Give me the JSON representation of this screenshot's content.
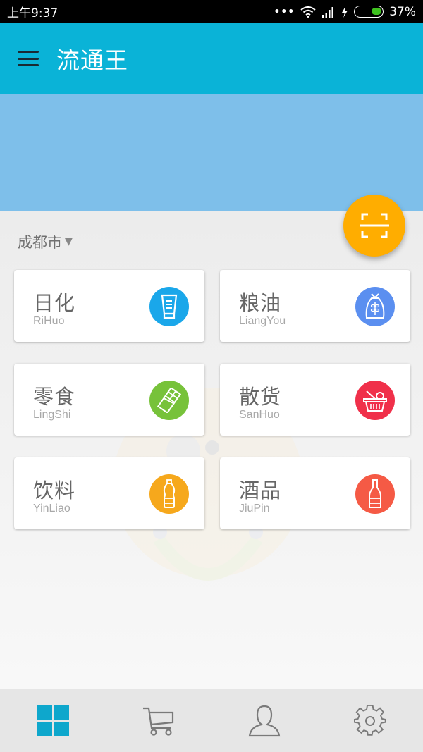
{
  "status_bar": {
    "time": "上午9:37",
    "dots": "•••",
    "battery_percent": "37%",
    "battery_level": 0.37
  },
  "app_bar": {
    "title": "流通王",
    "menu_icon": "hamburger-menu-icon"
  },
  "location": {
    "city": "成都市",
    "dropdown_glyph": "▼"
  },
  "fab": {
    "icon": "scan-icon"
  },
  "categories": [
    {
      "name": "日化",
      "pinyin": "RiHuo",
      "icon": "lotion-tube-icon",
      "color": "#1aa7ea"
    },
    {
      "name": "粮油",
      "pinyin": "LiangYou",
      "icon": "grain-sack-icon",
      "color": "#5b8ff0"
    },
    {
      "name": "零食",
      "pinyin": "LingShi",
      "icon": "chocolate-bar-icon",
      "color": "#77c23a"
    },
    {
      "name": "散货",
      "pinyin": "SanHuo",
      "icon": "basket-icon",
      "color": "#f0304a"
    },
    {
      "name": "饮料",
      "pinyin": "YinLiao",
      "icon": "bottle-icon",
      "color": "#f6a81c"
    },
    {
      "name": "酒品",
      "pinyin": "JiuPin",
      "icon": "wine-bottle-icon",
      "color": "#f55a45"
    }
  ],
  "tab_bar": {
    "active_color": "#0ea7cc",
    "inactive_color": "#7a7a7a",
    "tabs": [
      {
        "id": "home",
        "icon": "grid-icon",
        "active": true
      },
      {
        "id": "cart",
        "icon": "cart-icon",
        "active": false
      },
      {
        "id": "profile",
        "icon": "user-icon",
        "active": false
      },
      {
        "id": "settings",
        "icon": "gear-icon",
        "active": false
      }
    ]
  }
}
